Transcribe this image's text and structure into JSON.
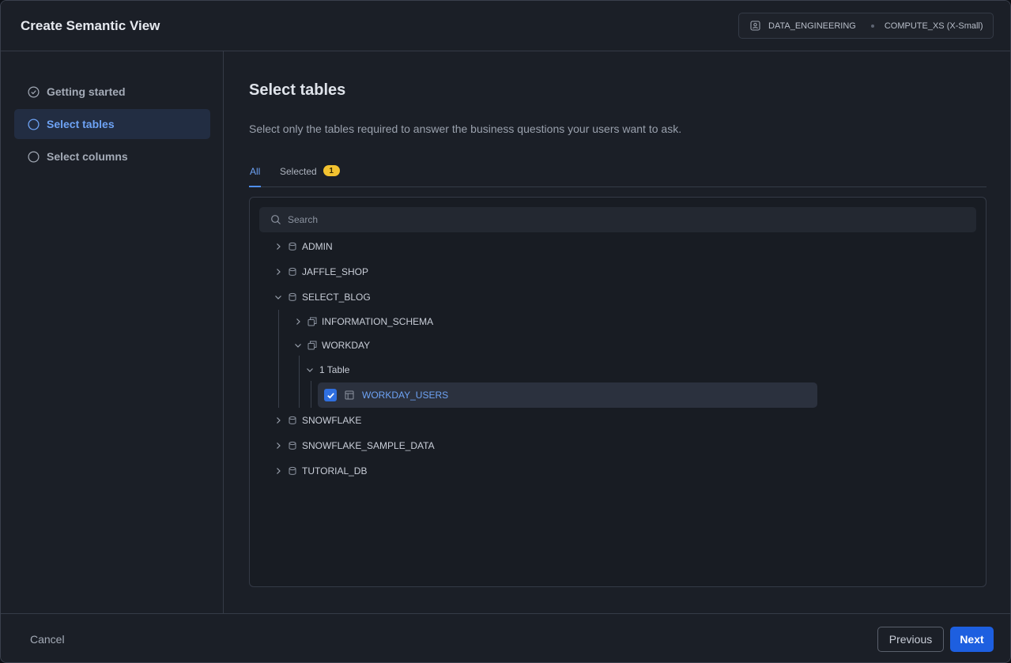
{
  "dialog": {
    "title": "Create Semantic View",
    "context": {
      "role": "DATA_ENGINEERING",
      "warehouse": "COMPUTE_XS (X-Small)"
    }
  },
  "sidebar": {
    "steps": [
      {
        "label": "Getting started",
        "state": "done"
      },
      {
        "label": "Select tables",
        "state": "active"
      },
      {
        "label": "Select columns",
        "state": "pending"
      }
    ]
  },
  "main": {
    "heading": "Select tables",
    "description": "Select only the tables required to answer the business questions your users want to ask.",
    "tabs": {
      "all": "All",
      "selected": "Selected",
      "selected_count": "1"
    },
    "search": {
      "placeholder": "Search",
      "value": ""
    },
    "tree": {
      "admin": "ADMIN",
      "jaffle_shop": "JAFFLE_SHOP",
      "select_blog": "SELECT_BLOG",
      "information_schema": "INFORMATION_SCHEMA",
      "workday": "WORKDAY",
      "tables_group": "1 Table",
      "workday_users": "WORKDAY_USERS",
      "workday_users_checked": true,
      "snowflake": "SNOWFLAKE",
      "snowflake_sample_data": "SNOWFLAKE_SAMPLE_DATA",
      "tutorial_db": "TUTORIAL_DB"
    }
  },
  "footer": {
    "cancel": "Cancel",
    "previous": "Previous",
    "next": "Next"
  },
  "colors": {
    "accent": "#1d5fe0",
    "active_text": "#6ea3f5",
    "badge": "#f2c230"
  }
}
